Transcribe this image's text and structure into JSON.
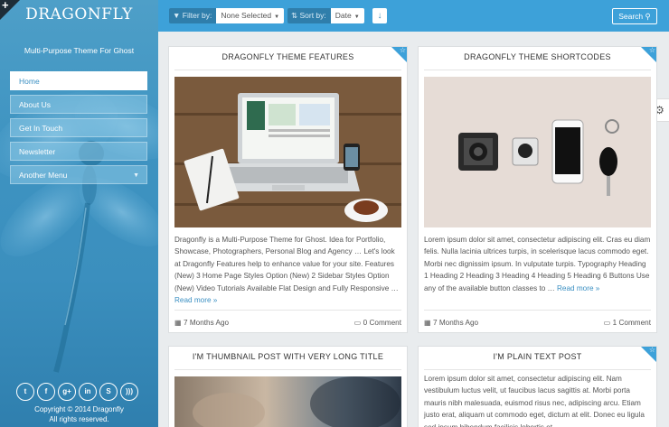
{
  "sidebar": {
    "brand": "DRAGONFLY",
    "tagline": "Multi-Purpose Theme For Ghost",
    "menu": [
      {
        "label": "Home"
      },
      {
        "label": "About Us"
      },
      {
        "label": "Get In Touch"
      },
      {
        "label": "Newsletter"
      },
      {
        "label": "Another Menu"
      }
    ],
    "social": [
      "twitter-icon",
      "facebook-icon",
      "google-plus-icon",
      "linkedin-icon",
      "skype-icon",
      "rss-icon"
    ],
    "copyright_line1": "Copyright © 2014 Dragonfly",
    "copyright_line2": "All rights reserved."
  },
  "toolbar": {
    "filter_label": "Filter by:",
    "filter_value": "None Selected",
    "sort_label": "Sort by:",
    "sort_value": "Date",
    "search_label": "Search"
  },
  "accent_color": "#3da1d9",
  "posts": [
    {
      "title": "DRAGONFLY THEME FEATURES",
      "excerpt": "Dragonfly is a Multi-Purpose Theme for Ghost. Idea for Portfolio, Showcase, Photographers, Personal Blog and Agency … Let's look at Dragonfly Features help to enhance value for your site. Features (New) 3 Home Page Styles Option (New) 2 Sidebar Styles Option (New) Video Tutorials Available Flat Design and Fully Responsive …",
      "more": "Read more »",
      "date": "7 Months Ago",
      "comments": "0 Comment",
      "featured": true
    },
    {
      "title": "DRAGONFLY THEME SHORTCODES",
      "excerpt": "Lorem ipsum dolor sit amet, consectetur adipiscing elit. Cras eu diam felis. Nulla lacinia ultrices turpis, in scelerisque lacus commodo eget. Morbi nec dignissim ipsum. In vulputate turpis. Typography Heading 1 Heading 2 Heading 3 Heading 4 Heading 5 Heading 6 Buttons Use any of the available button classes to …",
      "more": "Read more »",
      "date": "7 Months Ago",
      "comments": "1 Comment",
      "featured": true
    },
    {
      "title": "I'M THUMBNAIL POST WITH VERY LONG TITLE",
      "featured": false
    },
    {
      "title": "I'M PLAIN TEXT POST",
      "excerpt": "Lorem ipsum dolor sit amet, consectetur adipiscing elit. Nam vestibulum luctus velit, ut faucibus lacus sagittis at. Morbi porta mauris nibh malesuada, euismod risus nec, adipiscing arcu. Etiam justo erat, aliquam ut commodo eget, dictum at elit. Donec eu ligula sed ipsum bibendum facilisis lobortis et",
      "featured": true
    }
  ]
}
